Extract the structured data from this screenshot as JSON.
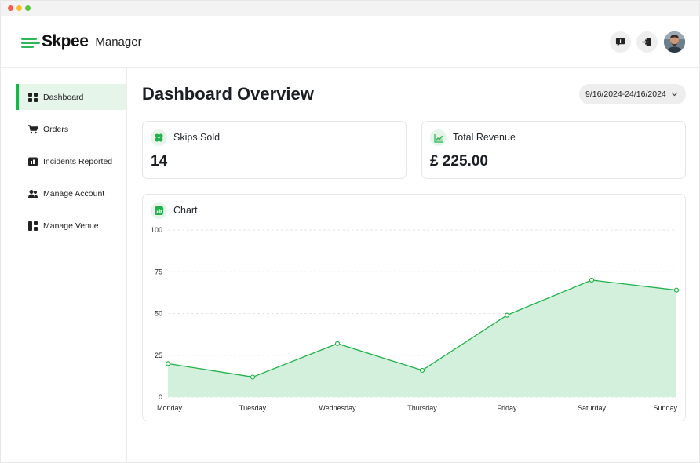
{
  "app": {
    "brand": "Skpee",
    "subtitle": "Manager"
  },
  "header": {
    "icons": [
      "chat-alert-icon",
      "logout-icon"
    ],
    "avatar_alt": "user-avatar"
  },
  "sidebar": {
    "items": [
      {
        "label": "Dashboard",
        "icon": "dashboard-icon",
        "active": true
      },
      {
        "label": "Orders",
        "icon": "cart-icon",
        "active": false
      },
      {
        "label": "Incidents Reported",
        "icon": "incident-icon",
        "active": false
      },
      {
        "label": "Manage Account",
        "icon": "users-icon",
        "active": false
      },
      {
        "label": "Manage Venue",
        "icon": "venue-icon",
        "active": false
      }
    ]
  },
  "main": {
    "title": "Dashboard Overview",
    "date_range": "9/16/2024-24/16/2024"
  },
  "cards": {
    "skips": {
      "title": "Skips Sold",
      "value": "14",
      "icon": "skips-icon"
    },
    "revenue": {
      "title": "Total Revenue",
      "value": "£ 225.00",
      "icon": "revenue-icon"
    }
  },
  "chart": {
    "title": "Chart",
    "icon": "chart-icon"
  },
  "colors": {
    "accent": "#22b04b",
    "accent_light": "#e6f5ea",
    "area_fill": "#d3f0dc"
  },
  "chart_data": {
    "type": "area",
    "categories": [
      "Monday",
      "Tuesday",
      "Wednesday",
      "Thursday",
      "Friday",
      "Saturday",
      "Sunday"
    ],
    "values": [
      20,
      12,
      32,
      16,
      49,
      70,
      64
    ],
    "yticks": [
      0,
      25,
      50,
      75,
      100
    ],
    "ylim": [
      0,
      100
    ],
    "grid": true,
    "title": "Chart"
  }
}
